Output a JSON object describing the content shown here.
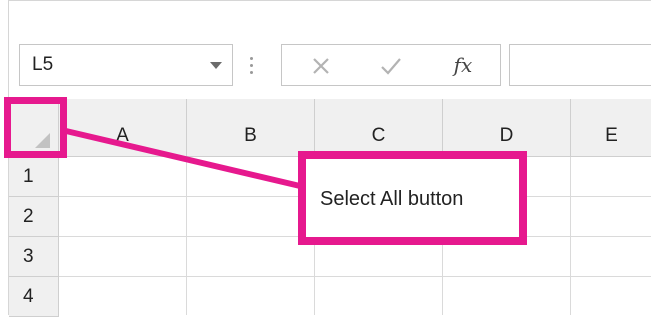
{
  "formula_bar": {
    "name_box_value": "L5",
    "cancel_icon": "close-icon",
    "enter_icon": "checkmark-icon",
    "insert_function_label": "fx",
    "formula_value": ""
  },
  "sheet": {
    "columns": [
      "A",
      "B",
      "C",
      "D",
      "E"
    ],
    "rows": [
      "1",
      "2",
      "3",
      "4"
    ],
    "select_all_icon": "corner-triangle-icon"
  },
  "annotation": {
    "callout_text": "Select All button",
    "highlight_color": "#e6198e"
  },
  "colors": {
    "header_bg": "#f0f0f0",
    "gridline": "#dadada",
    "accent": "#e6198e"
  }
}
